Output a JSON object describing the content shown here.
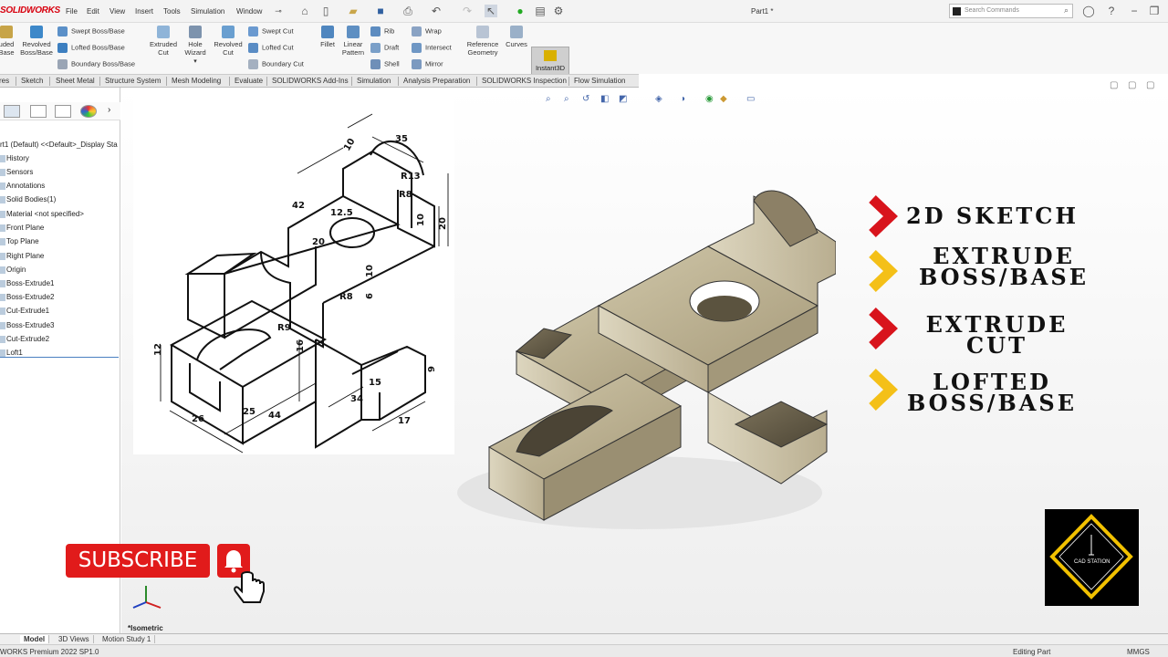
{
  "app": {
    "logo": "SOLIDWORKS",
    "document_title": "Part1 *"
  },
  "menu": [
    "File",
    "Edit",
    "View",
    "Insert",
    "Tools",
    "Simulation",
    "Window"
  ],
  "search": {
    "placeholder": "Search Commands"
  },
  "ribbon": {
    "left_partial": [
      "uded",
      "Base"
    ],
    "revolved_boss": [
      "Revolved",
      "Boss/Base"
    ],
    "swept_boss": "Swept Boss/Base",
    "lofted_boss": "Lofted Boss/Base",
    "boundary_boss": "Boundary Boss/Base",
    "extruded_cut": [
      "Extruded",
      "Cut"
    ],
    "hole_wizard": [
      "Hole",
      "Wizard"
    ],
    "revolved_cut": [
      "Revolved",
      "Cut"
    ],
    "swept_cut": "Swept Cut",
    "lofted_cut": "Lofted Cut",
    "boundary_cut": "Boundary Cut",
    "fillet": "Fillet",
    "linear_pattern": [
      "Linear",
      "Pattern"
    ],
    "rib": "Rib",
    "draft": "Draft",
    "shell": "Shell",
    "wrap": "Wrap",
    "intersect": "Intersect",
    "mirror": "Mirror",
    "reference_geometry": [
      "Reference",
      "Geometry"
    ],
    "curves": "Curves",
    "instant3d": "Instant3D"
  },
  "command_tabs": [
    "res",
    "Sketch",
    "Sheet Metal",
    "Structure System",
    "Mesh Modeling",
    "Evaluate",
    "SOLIDWORKS Add-Ins",
    "Simulation",
    "Analysis Preparation",
    "SOLIDWORKS Inspection",
    "Flow Simulation"
  ],
  "feature_tree": {
    "root": "rt1 (Default) <<Default>_Display Sta",
    "items": [
      "History",
      "Sensors",
      "Annotations",
      "Solid Bodies(1)",
      "Material <not specified>",
      "Front Plane",
      "Top Plane",
      "Right Plane",
      "Origin",
      "Boss-Extrude1",
      "Boss-Extrude2",
      "Cut-Extrude1",
      "Boss-Extrude3",
      "Cut-Extrude2",
      "Loft1"
    ]
  },
  "drawing_dims": {
    "d35": "35",
    "d10a": "10",
    "r13": "R13",
    "r8": "R8",
    "d42": "42",
    "d12_5": "12.5",
    "d10b": "10",
    "d20a": "20",
    "d20b": "20",
    "d10c": "10",
    "d6": "6",
    "r8b": "R8",
    "r9": "R9",
    "d12": "12",
    "d16": "16",
    "d9": "9",
    "d15": "15",
    "d34": "34",
    "d17": "17",
    "d26": "26",
    "d25": "25",
    "d44": "44"
  },
  "features": [
    {
      "line1": "2D SKETCH",
      "line2": "",
      "chevron_color": "#d8141c"
    },
    {
      "line1": "EXTRUDE",
      "line2": "BOSS/BASE",
      "chevron_color": "#f4c018"
    },
    {
      "line1": "EXTRUDE",
      "line2": "CUT",
      "chevron_color": "#d8141c"
    },
    {
      "line1": "LOFTED",
      "line2": "BOSS/BASE",
      "chevron_color": "#f4c018"
    }
  ],
  "subscribe": {
    "label": "SUBSCRIBE",
    "color": "#e11b1b"
  },
  "channel_logo": {
    "text": "CAD STATION",
    "accent": "#f2c100"
  },
  "viewport": {
    "view_name": "*Isometric"
  },
  "bottom_tabs": [
    "Model",
    "3D Views",
    "Motion Study 1"
  ],
  "status": {
    "version": "WORKS Premium 2022 SP1.0",
    "mode": "Editing Part",
    "units": "MMGS"
  }
}
